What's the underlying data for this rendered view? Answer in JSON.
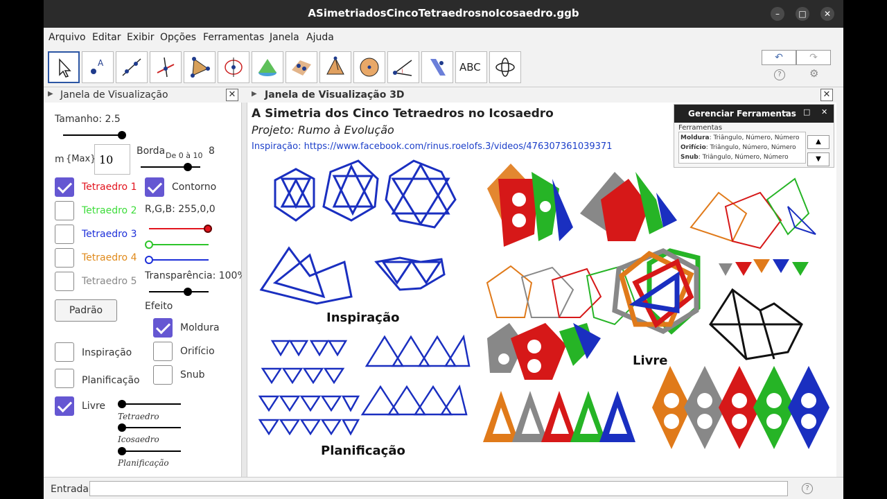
{
  "window": {
    "title": "ASimetriadosCincoTetraedrosnoIcosaedro.ggb",
    "minimize": "–",
    "maximize": "□",
    "close": "✕"
  },
  "menu": [
    "Arquivo",
    "Editar",
    "Exibir",
    "Opções",
    "Ferramentas",
    "Janela",
    "Ajuda"
  ],
  "toolbar": {
    "undo": "↶",
    "redo": "↷",
    "help": "?",
    "settings": "⚙",
    "text_tool": "ABC"
  },
  "left_panel": {
    "header": "Janela de Visualização",
    "size_label": "Tamanho: 2.5",
    "m_label": "m",
    "max_label": "{Max}",
    "max_value": "10",
    "border_label": "Borda",
    "border_range": "De 0 à 10",
    "border_value": "8",
    "tetra": [
      {
        "label": "Tetraedro 1",
        "color": "#e2131d",
        "checked": true
      },
      {
        "label": "Tetraedro 2",
        "color": "#3ddc3a",
        "checked": false
      },
      {
        "label": "Tetraedro 3",
        "color": "#1d2fd9",
        "checked": false
      },
      {
        "label": "Tetraedro 4",
        "color": "#e08a1b",
        "checked": false
      },
      {
        "label": "Tetraedro 5",
        "color": "#888888",
        "checked": false
      }
    ],
    "contour_label": "Contorno",
    "rgb_label": "R,G,B: 255,0,0",
    "transparency_label": "Transparência: 100%",
    "default_button": "Padrão",
    "effect_label": "Efeito",
    "effects": [
      "Moldura",
      "Orifício",
      "Snub"
    ],
    "views": [
      "Inspiração",
      "Planificação",
      "Livre"
    ],
    "sliders": [
      "Tetraedro",
      "Icosaedro",
      "Planificação"
    ]
  },
  "view3d": {
    "header": "Janela de Visualização 3D",
    "title": "A Simetria dos Cinco Tetraedros no Icosaedro",
    "subtitle": "Projeto: Rumo à Evolução",
    "link": "Inspiração: https://www.facebook.com/rinus.roelofs.3/videos/476307361039371",
    "captions": [
      "Inspiração",
      "Planificação",
      "Livre"
    ]
  },
  "tool_manager": {
    "title": "Gerenciar Ferramentas",
    "section": "Ferramentas",
    "items": [
      {
        "name": "Moldura",
        "desc": ": Triângulo, Número, Número"
      },
      {
        "name": "Orifício",
        "desc": ": Triângulo, Número, Número"
      },
      {
        "name": "Snub",
        "desc": ": Triângulo, Número, Número"
      }
    ],
    "up": "▲",
    "down": "▼"
  },
  "entry": {
    "label": "Entrada:",
    "help": "?"
  }
}
